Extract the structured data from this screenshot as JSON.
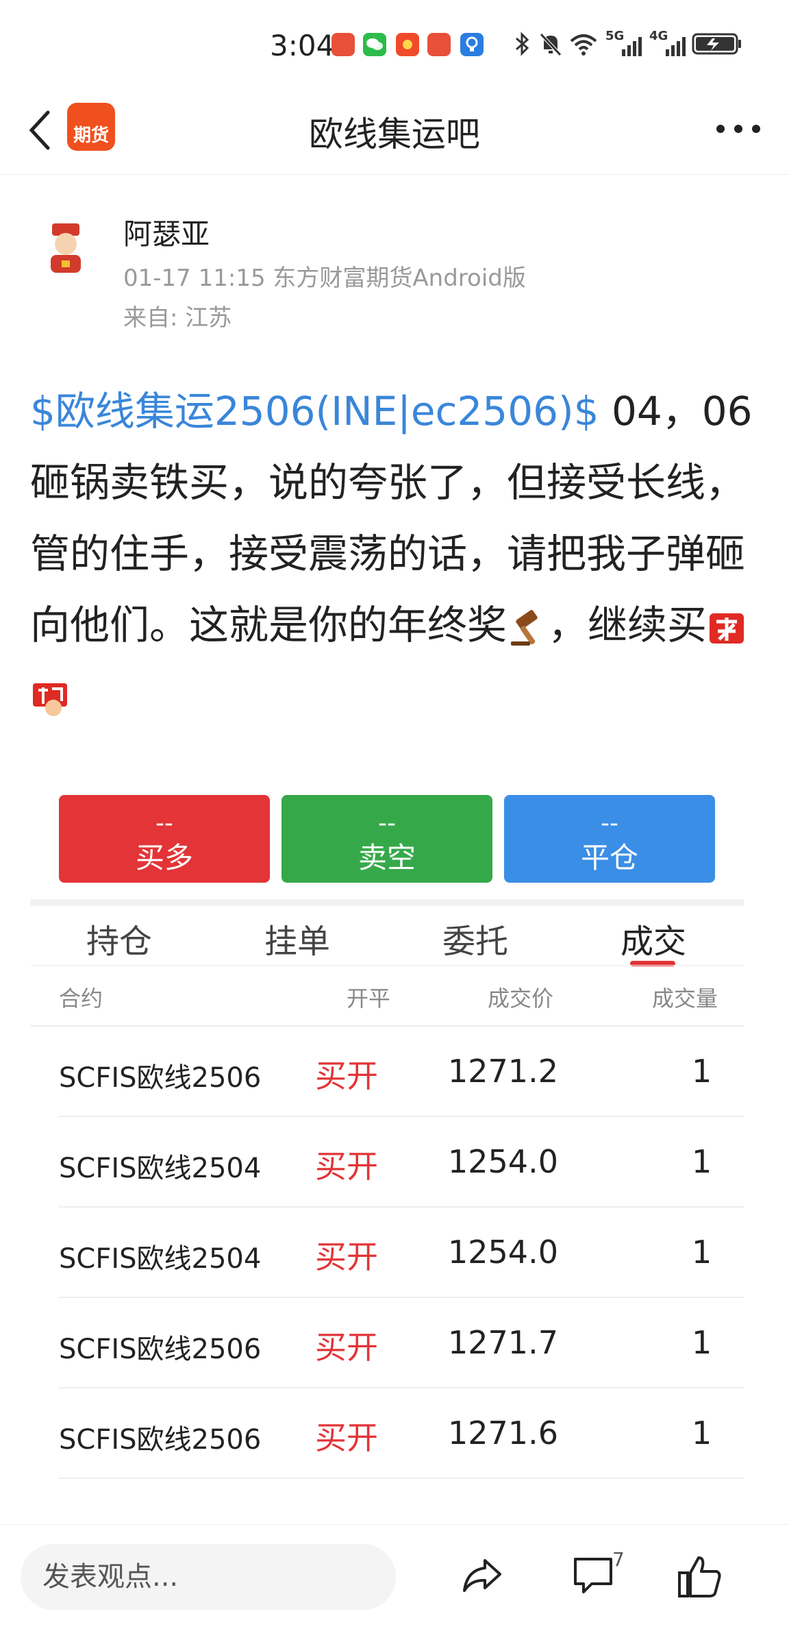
{
  "status_bar": {
    "time": "3:04",
    "icons": [
      "mascot-app-icon",
      "wechat-icon",
      "red-app-icon",
      "mascot-app-icon",
      "blue-app-icon",
      "bluetooth-icon",
      "mute-icon",
      "wifi-icon",
      "5g-signal-icon",
      "4g-signal-icon",
      "battery-charging-icon"
    ],
    "signal_5g": "5G",
    "signal_4g": "4G"
  },
  "header": {
    "back_icon": "chevron-left-icon",
    "logo_text": "期货",
    "title": "欧线集运吧",
    "more_icon": "more-horizontal-icon"
  },
  "post": {
    "author": "阿瑟亚",
    "meta": "01-17 11:15 东方财富期货Android版",
    "from": "来自: 江苏",
    "stock_link": "$欧线集运2506(INE|ec2506)$",
    "text_1": " 04，06砸锅卖铁买，说的夸张了，但接受长线，管的住手，接受震荡的话，请把我子弹砸向他们。这就是你的年终奖",
    "text_2": "，继续买",
    "emoji_1": "gavel-icon",
    "emoji_2": "buy-sticker-icon",
    "emoji_3": "grab-sticker-icon"
  },
  "trade_buttons": {
    "buy": {
      "dash": "--",
      "label": "买多"
    },
    "sell": {
      "dash": "--",
      "label": "卖空"
    },
    "close": {
      "dash": "--",
      "label": "平仓"
    }
  },
  "tabs": [
    {
      "label": "持仓"
    },
    {
      "label": "挂单"
    },
    {
      "label": "委托"
    },
    {
      "label": "成交",
      "active": true
    }
  ],
  "table": {
    "headers": {
      "contract": "合约",
      "open_close": "开平",
      "price": "成交价",
      "quantity": "成交量"
    },
    "rows": [
      {
        "contract": "SCFIS欧线2506",
        "open_close": "买开",
        "price": "1271.2",
        "quantity": "1"
      },
      {
        "contract": "SCFIS欧线2504",
        "open_close": "买开",
        "price": "1254.0",
        "quantity": "1"
      },
      {
        "contract": "SCFIS欧线2504",
        "open_close": "买开",
        "price": "1254.0",
        "quantity": "1"
      },
      {
        "contract": "SCFIS欧线2506",
        "open_close": "买开",
        "price": "1271.7",
        "quantity": "1"
      },
      {
        "contract": "SCFIS欧线2506",
        "open_close": "买开",
        "price": "1271.6",
        "quantity": "1"
      }
    ]
  },
  "bottom_bar": {
    "comment_placeholder": "发表观点...",
    "share_icon": "share-icon",
    "comment_icon": "comment-icon",
    "comment_count": "7",
    "like_icon": "thumbs-up-icon"
  },
  "colors": {
    "buy": "#e33437",
    "sell": "#35a94a",
    "close": "#3a8ee6",
    "link": "#3a86d9",
    "logo": "#f0501e"
  }
}
